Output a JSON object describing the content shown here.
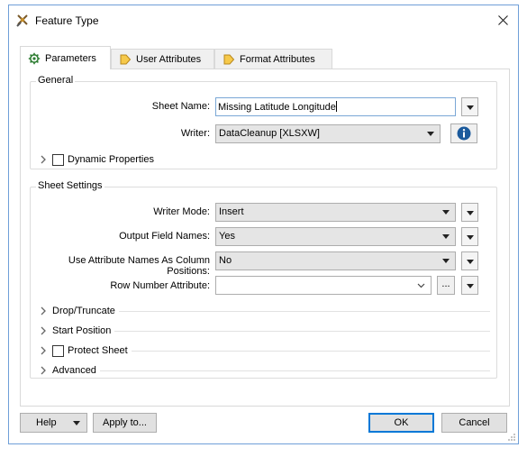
{
  "window": {
    "title": "Feature Type"
  },
  "tabs": [
    {
      "label": "Parameters",
      "icon": "gear-icon",
      "active": true
    },
    {
      "label": "User Attributes",
      "icon": "tag-arrow-icon",
      "active": false
    },
    {
      "label": "Format Attributes",
      "icon": "tag-arrow-icon",
      "active": false
    }
  ],
  "general": {
    "title": "General",
    "sheet_name_label": "Sheet Name:",
    "sheet_name_value": "Missing Latitude Longitude",
    "writer_label": "Writer:",
    "writer_value": "DataCleanup [XLSXW]",
    "dynamic_properties_label": "Dynamic Properties",
    "dynamic_properties_checked": false
  },
  "sheet_settings": {
    "title": "Sheet Settings",
    "writer_mode_label": "Writer Mode:",
    "writer_mode_value": "Insert",
    "output_field_names_label": "Output Field Names:",
    "output_field_names_value": "Yes",
    "use_attr_names_label": "Use Attribute Names As Column Positions:",
    "use_attr_names_value": "No",
    "row_number_attr_label": "Row Number Attribute:",
    "row_number_attr_value": "",
    "ellipsis": "...",
    "sections": [
      {
        "label": "Drop/Truncate",
        "has_checkbox": false
      },
      {
        "label": "Start Position",
        "has_checkbox": false
      },
      {
        "label": "Protect Sheet",
        "has_checkbox": true,
        "checked": false
      },
      {
        "label": "Advanced",
        "has_checkbox": false
      }
    ]
  },
  "footer": {
    "help_label": "Help",
    "apply_label": "Apply to...",
    "ok_label": "OK",
    "cancel_label": "Cancel"
  },
  "colors": {
    "accent": "#0078d7",
    "info_icon": "#1b5a9c",
    "combo_bg": "#e5e5e5"
  }
}
